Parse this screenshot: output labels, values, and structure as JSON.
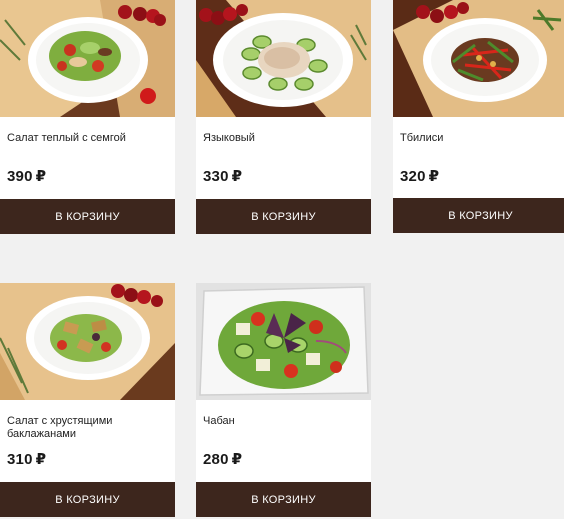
{
  "products": [
    {
      "name": "Салат теплый с семгой",
      "price": "390",
      "currency": "₽",
      "button": "В КОРЗИНУ",
      "image_icon": "warm-salmon-salad-photo"
    },
    {
      "name": "Языковый",
      "price": "330",
      "currency": "₽",
      "button": "В КОРЗИНУ",
      "image_icon": "tongue-salad-photo"
    },
    {
      "name": "Тбилиси",
      "price": "320",
      "currency": "₽",
      "button": "В КОРЗИНУ",
      "image_icon": "tbilisi-salad-photo"
    },
    {
      "name": "Салат с хрустящими баклажанами",
      "price": "310",
      "currency": "₽",
      "button": "В КОРЗИНУ",
      "image_icon": "eggplant-salad-photo"
    },
    {
      "name": "Чабан",
      "price": "280",
      "currency": "₽",
      "button": "В КОРЗИНУ",
      "image_icon": "shepherd-salad-photo"
    }
  ],
  "colors": {
    "page_background": "#f1f1f1",
    "card_background": "#ffffff",
    "button_background": "#3d261d",
    "button_text": "#ffffff"
  }
}
